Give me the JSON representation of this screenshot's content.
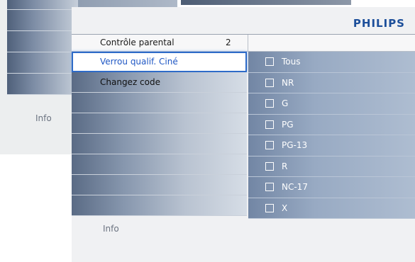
{
  "background_menu": {
    "info_label": "Info"
  },
  "brand": "PHILIPS",
  "header": {
    "label": "Contrôle parental",
    "value": "2"
  },
  "menu": {
    "items": [
      {
        "label": "Verrou qualif. Ciné",
        "selected": true
      },
      {
        "label": "Changez code"
      },
      {
        "label": ""
      },
      {
        "label": ""
      },
      {
        "label": ""
      },
      {
        "label": ""
      },
      {
        "label": ""
      },
      {
        "label": ""
      }
    ]
  },
  "ratings": {
    "options": [
      {
        "label": "Tous",
        "checked": false
      },
      {
        "label": "NR",
        "checked": false
      },
      {
        "label": "G",
        "checked": false
      },
      {
        "label": "PG",
        "checked": false
      },
      {
        "label": "PG-13",
        "checked": false
      },
      {
        "label": "R",
        "checked": false
      },
      {
        "label": "NC-17",
        "checked": false
      },
      {
        "label": "X",
        "checked": false
      }
    ]
  },
  "info_label": "Info",
  "colors": {
    "accent": "#2e6bc8",
    "brand": "#1d4f9a"
  }
}
